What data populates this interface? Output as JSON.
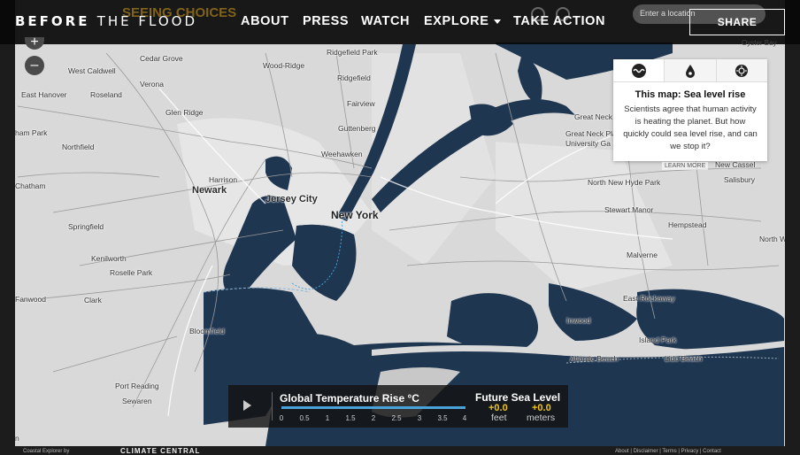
{
  "nav": {
    "logo_bold": "BEFORE",
    "logo_thin": "THE FLOOD",
    "ghost_text": "SEEING CHOICES",
    "items": [
      {
        "label": "ABOUT"
      },
      {
        "label": "PRESS"
      },
      {
        "label": "WATCH"
      },
      {
        "label": "EXPLORE"
      },
      {
        "label": "TAKE ACTION"
      }
    ],
    "search_placeholder": "Enter a location",
    "share_label": "SHARE"
  },
  "zoom": {
    "in": "+",
    "out": "–"
  },
  "info_panel": {
    "tabs": [
      {
        "icon": "wave-icon",
        "active": true
      },
      {
        "icon": "drop-icon",
        "active": false
      },
      {
        "icon": "sun-icon",
        "active": false
      }
    ],
    "title": "This map: Sea level rise",
    "text": "Scientists agree that human activity is heating the planet. But how quickly could sea level rise, and can we stop it?",
    "learn_more": "LEARN MORE"
  },
  "map_labels": {
    "cedar_grove": "Cedar Grove",
    "west_caldwell": "West Caldwell",
    "verona": "Verona",
    "wood_ridge": "Wood-Ridge",
    "ridgefield_park": "Ridgefield Park",
    "ridgefield": "Ridgefield",
    "east_hanover": "East Hanover",
    "roseland": "Roseland",
    "glen_ridge": "Glen Ridge",
    "fairview": "Fairview",
    "guttenberg": "Guttenberg",
    "ham_park": "ham Park",
    "northfield": "Northfield",
    "weehawken": "Weehawken",
    "harrison": "Harrison",
    "newark": "Newark",
    "chatham": "Chatham",
    "jersey_city": "Jersey City",
    "new_york": "New York",
    "springfield": "Springfield",
    "kenilworth": "Kenilworth",
    "roselle_park": "Roselle Park",
    "fanwood": "Fanwood",
    "clark": "Clark",
    "bloomfield": "Bloomfield",
    "port_reading": "Port Reading",
    "sewaren": "Sewaren",
    "great_neck": "Great Neck",
    "great_neck_plaza": "Great Neck Plaza",
    "university_ga": "University Ga",
    "new_cassel": "New Cassel",
    "salisbury": "Salisbury",
    "north_new_hyde_park": "North New Hyde Park",
    "stewart_manor": "Stewart Manor",
    "hempstead": "Hempstead",
    "malverne": "Malverne",
    "north_w": "North W",
    "east_rockaway": "East Rockaway",
    "inwood": "Inwood",
    "island_park": "Island Park",
    "atlantic_beach": "Atlantic Beach",
    "lido_beach": "Lido Beach",
    "oyster_bay": "Oyster Bay",
    "n_label": "n"
  },
  "control": {
    "title": "Global Temperature Rise °C",
    "ticks": [
      "0",
      "0.5",
      "1",
      "1.5",
      "2",
      "2.5",
      "3",
      "3.5",
      "4"
    ],
    "sea_title": "Future Sea Level",
    "feet_value": "+0.0",
    "feet_unit": "feet",
    "meters_value": "+0.0",
    "meters_unit": "meters"
  },
  "footer": {
    "left": "Coastal Explorer by",
    "logo": "CLIMATE CENTRAL",
    "right": "About | Disclaimer | Terms | Privacy | Contact"
  },
  "colors": {
    "water": "#1f3651",
    "land": "#dcdcdc",
    "accent": "#f0c419",
    "slider": "#4aa3d8"
  }
}
